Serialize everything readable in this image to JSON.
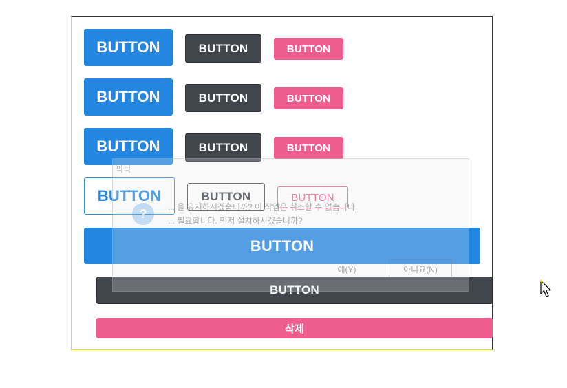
{
  "colors": {
    "blue": "#2387e1",
    "dark": "#41464c",
    "pink": "#ef5d8e",
    "frame_accent": "#e8e000"
  },
  "rows": [
    {
      "large": "BUTTON",
      "medium": "BUTTON",
      "small": "BUTTON"
    },
    {
      "large": "BUTTON",
      "medium": "BUTTON",
      "small": "BUTTON"
    },
    {
      "large": "BUTTON",
      "medium": "BUTTON",
      "small": "BUTTON"
    }
  ],
  "outline_row": {
    "large": "BUTTON",
    "medium": "BUTTON",
    "small": "BUTTON"
  },
  "full_buttons": {
    "blue": "BUTTON",
    "dark": "BUTTON",
    "pink": "삭제"
  },
  "ghost_dialog": {
    "title": "픽픽",
    "icon": "question-icon",
    "icon_glyph": "?",
    "message": "... 을 유지하시겠습니까? 이 작업은 취소할 수 없습니다.",
    "message_line2": "... 필요합니다. 먼저 설치하시겠습니까?",
    "yes": "예(Y)",
    "no": "아니요(N)"
  },
  "cursor": {
    "icon": "mouse-pointer-icon"
  }
}
